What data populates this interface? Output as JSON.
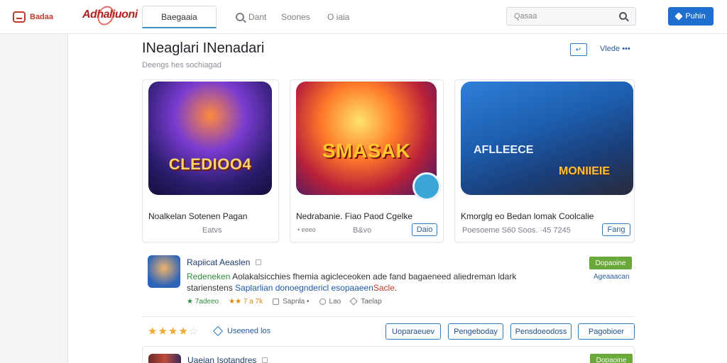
{
  "sidebar": {
    "brand_label": "Badaa"
  },
  "topbar": {
    "logo": "Adhaliuoni",
    "tab_active": "Baegaaia",
    "tab_search": "Dant",
    "tab_scores": "Soones",
    "tab_more": "O iaia",
    "search_placeholder": "Qasaa",
    "publish_label": "Puhin"
  },
  "header": {
    "title": "INeaglari INenadari",
    "subtitle": "Deengs hes sochiagad",
    "btn_label": "↵",
    "view_link": "Vlede •••"
  },
  "cards": [
    {
      "art_text": "CLEDIOO4",
      "title": "Noalkelan Sotenen Pagan",
      "meta": "Eatvs",
      "pill": ""
    },
    {
      "art_text": "SMASAK",
      "title": "Nedrabanie. Fiao Paod Cgelke",
      "meta": "• eeeo",
      "meta2": "B&vo",
      "pill": "Daio"
    },
    {
      "art_text_a": "AFLLEECE",
      "art_text_b": "MONIIEIE",
      "title": "Kmorglg eo Bedan lomak Coolcalie",
      "meta": "Poesoeme S60 Soos. ·45 7245",
      "pill": "Fang"
    }
  ],
  "list": [
    {
      "title": "Rapiicat Aeaslen",
      "desc_a": "Redeneken",
      "desc_b": " Aolakalsicchies fhemia agicleceoken ade fand bagaeneed aliedreman ldark",
      "desc_c": "starienstens ",
      "desc_d": "Saplarlian donoegndericl esopaaeen",
      "desc_e": "Sacle",
      "desc_f": ".",
      "stat_rating": "★ 7adeeo",
      "stat_stars": "★★ 7 a 7k",
      "stat_likes": "Sapnla •",
      "stat_comments": "Lao",
      "stat_tags": "Taelap",
      "btn_label": "Dopaoine",
      "link_label": "Ageaaacan"
    },
    {
      "title": "Uaeian Isotandres",
      "btn_label": "Dopaoine"
    }
  ],
  "rating": {
    "value": 4,
    "max": 5,
    "stars_filled": "★★★★",
    "stars_empty": "☆",
    "rated_label": "Useened los"
  },
  "actions": [
    "Uoparaeuev",
    "Pengeboday",
    "Pensdoeodoss",
    "Pagobioer"
  ],
  "colors": {
    "accent": "#1e6fd0",
    "brand_red": "#c0392b",
    "green": "#6aa83a",
    "star": "#f0a830"
  }
}
